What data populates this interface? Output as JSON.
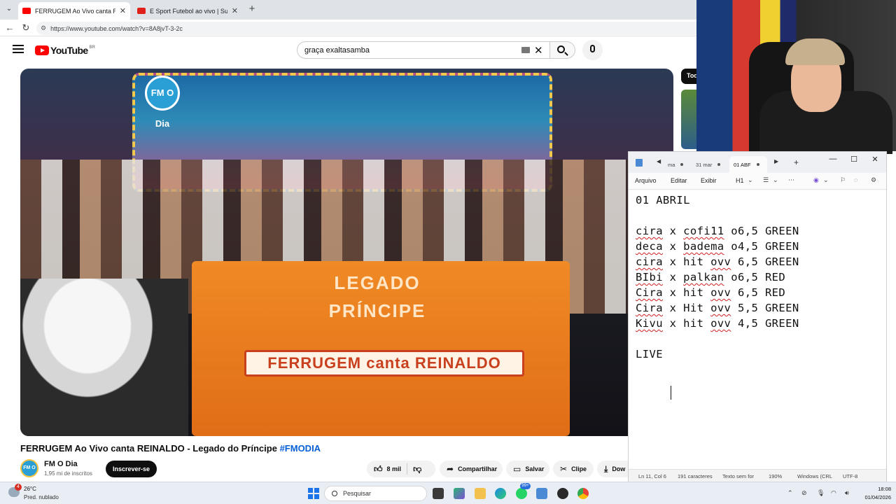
{
  "browser": {
    "tabs": [
      {
        "title": "FERRUGEM Ao Vivo canta REINALDO",
        "favicon_color": "#ff0000",
        "active": true
      },
      {
        "title": "E Sport Futebol ao vivo | Superbet",
        "favicon_color": "#e0201b",
        "active": false
      }
    ],
    "url": "https://www.youtube.com/watch?v=8A8jvT-3-2c"
  },
  "youtube": {
    "logo_text": "YouTube",
    "country_code": "BR",
    "search_value": "graça exaltasamba",
    "rail_chip": "Tod",
    "video_overlay": {
      "banner_logo": "FM O Dia",
      "table_top": "LEGADO PRÍNCIPE",
      "table_sign": "FERRUGEM canta REINALDO"
    },
    "video_title": "FERRUGEM Ao Vivo canta REINALDO - Legado do Príncipe",
    "video_hashtag": "#FMODIA",
    "channel": {
      "name": "FM O Dia",
      "subscribers": "1,95 mi de inscritos",
      "avatar_text": "FM O Dia"
    },
    "subscribe_label": "Inscrever-se",
    "actions": {
      "likes": "8 mil",
      "share": "Compartilhar",
      "save": "Salvar",
      "clip": "Clipe",
      "download": "Dow"
    }
  },
  "notepad": {
    "tabs": [
      {
        "label": "ma",
        "active": false
      },
      {
        "label": "31 mar",
        "active": false
      },
      {
        "label": "01 ABF",
        "active": true
      }
    ],
    "menu": {
      "file": "Arquivo",
      "edit": "Editar",
      "view": "Exibir",
      "heading": "H1"
    },
    "lines": [
      "01 ABRIL",
      "",
      "cira x cofi11 o6,5 GREEN",
      "deca x badema o4,5 GREEN",
      "cira x hit ovv 6,5 GREEN",
      "BIbi x palkan o6,5 RED",
      "Cira x hit ovv 6,5 RED",
      "Cira x Hit ovv 5,5 GREEN",
      "Kivu x hit ovv 4,5 GREEN",
      "",
      "LIVE "
    ],
    "status": {
      "position": "Ln 11, Col 6",
      "chars": "191 caracteres",
      "format": "Texto sem for",
      "zoom": "190%",
      "line_ending": "Windows (CRL",
      "encoding": "UTF-8"
    }
  },
  "taskbar": {
    "weather_badge": "4",
    "weather_temp": "26°C",
    "weather_desc": "Pred. nublado",
    "search_placeholder": "Pesquisar",
    "app_badge": "99+",
    "time": "18:08",
    "date": "01/04/2026"
  }
}
